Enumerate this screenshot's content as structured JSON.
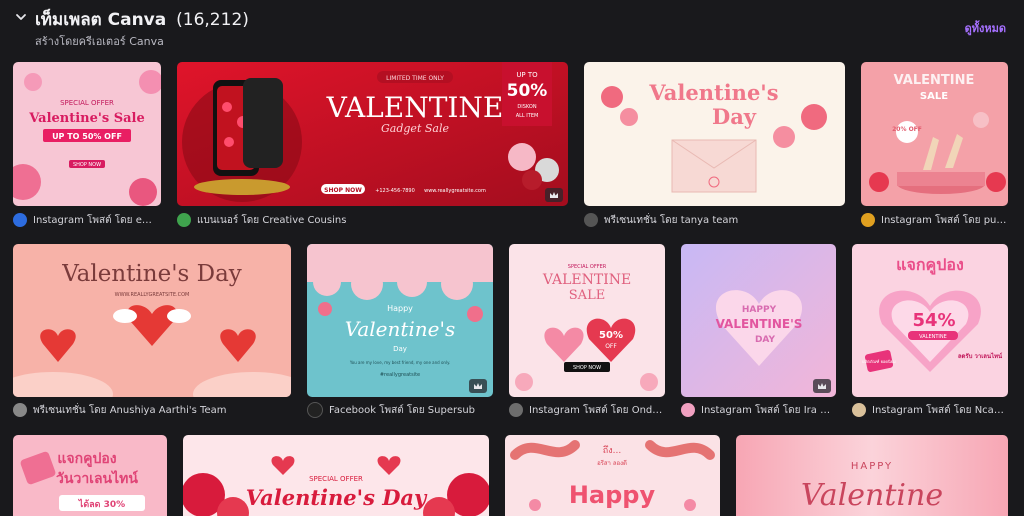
{
  "header": {
    "title": "เท็มเพลต Canva",
    "count": "(16,212)",
    "subtitle": "สร้างโดยครีเอเตอร์ Canva",
    "see_all": "ดูทั้งหมด"
  },
  "templates": {
    "row1": [
      {
        "title_text": "Valentine's Sale",
        "badge": "UP TO 50% OFF",
        "kicker": "SPECIAL OFFER",
        "cta": "SHOP NOW",
        "caption": "Instagram โพสต์ โดย emre the c...",
        "avatar_color": "#2d6cdf"
      },
      {
        "title_text": "VALENTINE",
        "script": "Gadget Sale",
        "kicker": "LIMITED TIME ONLY",
        "pct": "50%",
        "up_to": "UP TO",
        "pct_sub": "DISKON",
        "pct_sub2": "ALL ITEM",
        "cta": "SHOP NOW",
        "phone": "+123-456-7890",
        "site": "www.reallygreatsite.com",
        "caption": "แบนเนอร์ โดย Creative Cousins",
        "avatar_color": "#3fa34d"
      },
      {
        "title_text": "Valentine's",
        "title_text2": "Day",
        "caption": "พรีเซนเทชั่น โดย tanya team",
        "avatar_color": "#555"
      },
      {
        "title_text": "VALENTINE",
        "sub": "SALE",
        "badge": "20% OFF",
        "caption": "Instagram โพสต์ โดย puricreative",
        "avatar_color": "#e0a020"
      }
    ],
    "row2": [
      {
        "title_text": "Valentine's Day",
        "site": "WWW.REALLYGREATSITE.COM",
        "caption": "พรีเซนเทชั่น โดย Anushiya Aarthi's Team",
        "avatar_color": "#888"
      },
      {
        "kicker": "Happy",
        "title_text": "Valentine's",
        "sub": "Day",
        "body": "You are my love, my best friend, my one and only.",
        "handle": "#reallygreatsite",
        "caption": "Facebook โพสต์ โดย Supersub",
        "avatar_color": "#222"
      },
      {
        "kicker": "SPECIAL OFFER",
        "title_text": "VALENTINE",
        "sub": "SALE",
        "pct": "50%",
        "pct_sub": "OFF",
        "cta": "SHOP NOW",
        "caption": "Instagram โพสต์ โดย Ondo Studios",
        "avatar_color": "#6d6d6d"
      },
      {
        "title_text": "HAPPY",
        "title_text2": "VALENTINE'S",
        "title_text3": "DAY",
        "caption": "Instagram โพสต์ โดย Ira Grace",
        "avatar_color": "#f0a0c0"
      },
      {
        "title_text": "แจกคูปอง",
        "pct": "54%",
        "pct_sub": "VALENTINE",
        "note": "ลดรับ วาเลนไทน์",
        "tag": "ผลิตภัณฑ์ ยอดนิยม",
        "caption": "Instagram โพสต์ โดย Ncamew",
        "avatar_color": "#d9c09a"
      }
    ],
    "row3": [
      {
        "title_text": "แจกคูปอง",
        "title_text2": "วันวาเลนไทน์",
        "note": "ได้ลด 30%"
      },
      {
        "kicker": "SPECIAL OFFER",
        "title_text": "Valentine's Day"
      },
      {
        "kicker": "ถึง...",
        "kicker2": "อรีสา ลองดี",
        "title_text": "Happy"
      },
      {
        "kicker": "HAPPY",
        "title_text": "Valentine"
      }
    ]
  },
  "colors": {
    "accent": "#a570ff",
    "background": "#19191c"
  },
  "icons": {
    "collapse": "chevron-down-icon",
    "premium": "crown-icon"
  }
}
